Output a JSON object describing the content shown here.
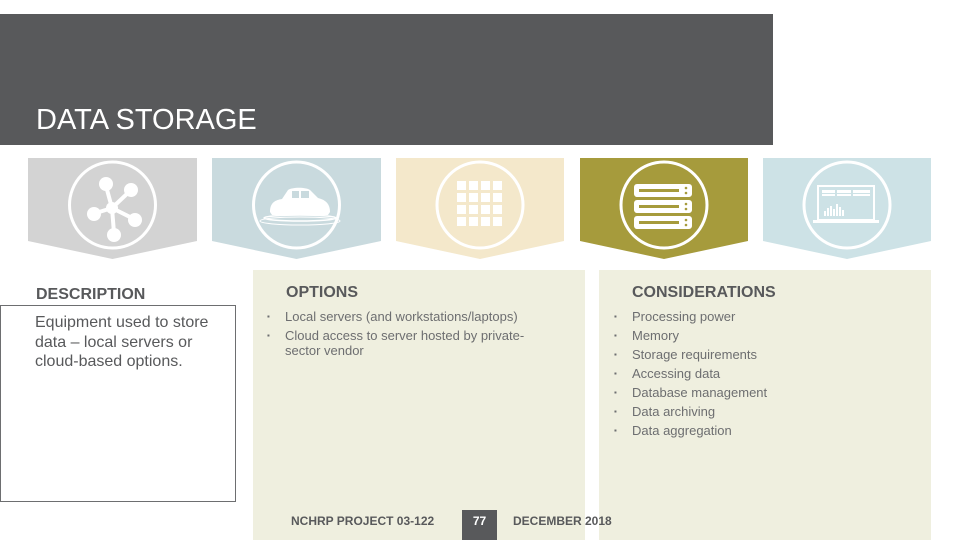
{
  "slide": {
    "title": "DATA STORAGE",
    "header_color": "#58595b"
  },
  "banners": [
    {
      "icon": "network-hub-icon",
      "color": "#d3d3d3"
    },
    {
      "icon": "connected-car-icon",
      "color": "#c9dade"
    },
    {
      "icon": "grid-icon",
      "color": "#f4e8cb"
    },
    {
      "icon": "server-stack-icon",
      "color": "#a69b3c"
    },
    {
      "icon": "laptop-dashboard-icon",
      "color": "#cde2e6"
    }
  ],
  "description": {
    "heading": "DESCRIPTION",
    "text": "Equipment used to store data – local servers or cloud-based options."
  },
  "options": {
    "heading": "OPTIONS",
    "items": [
      "Local servers (and workstations/laptops)",
      "Cloud access to server hosted by private-sector vendor"
    ]
  },
  "considerations": {
    "heading": "CONSIDERATIONS",
    "items": [
      "Processing power",
      "Memory",
      "Storage requirements",
      "Accessing data",
      "Database management",
      "Data archiving",
      "Data aggregation"
    ]
  },
  "footer": {
    "project": "NCHRP PROJECT 03-122",
    "page_number": "77",
    "date": "DECEMBER 2018"
  },
  "colors": {
    "panel_bg": "#efefdf",
    "text_dark": "#58595b"
  }
}
